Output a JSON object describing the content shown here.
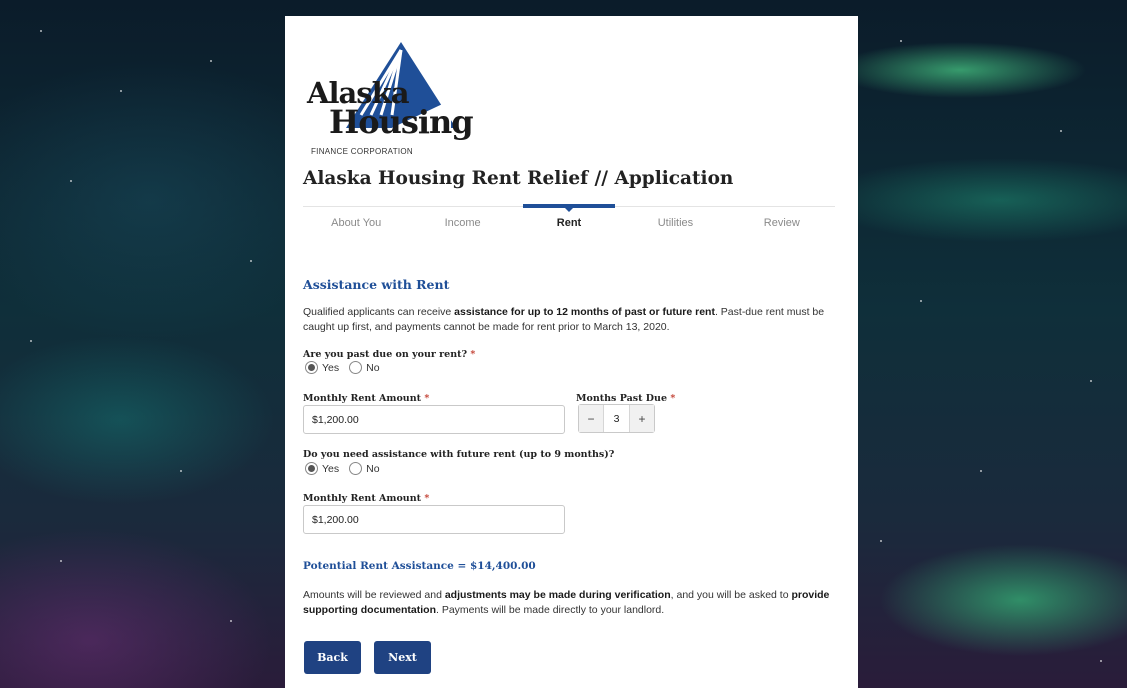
{
  "header": {
    "logo_line1": "Alaska",
    "logo_line2": "Housing",
    "logo_sub": "FINANCE CORPORATION",
    "title": "Alaska Housing Rent Relief // Application"
  },
  "steps": [
    {
      "label": "About You",
      "active": false
    },
    {
      "label": "Income",
      "active": false
    },
    {
      "label": "Rent",
      "active": true
    },
    {
      "label": "Utilities",
      "active": false
    },
    {
      "label": "Review",
      "active": false
    }
  ],
  "section": {
    "title": "Assistance with Rent",
    "intro_pre": "Qualified applicants can receive ",
    "intro_bold": "assistance for up to 12 months of past or future rent",
    "intro_post": ". Past-due rent must be caught up first, and payments cannot be made for rent prior to March 13, 2020."
  },
  "past_due": {
    "question": "Are you past due on your rent?",
    "required": "*",
    "yes_label": "Yes",
    "no_label": "No",
    "selected": "Yes"
  },
  "monthly_rent": {
    "label": "Monthly Rent Amount",
    "required": "*",
    "value": "$1,200.00"
  },
  "months_past_due": {
    "label": "Months Past Due",
    "required": "*",
    "minus": "−",
    "value": "3",
    "plus": "+"
  },
  "future_rent": {
    "question": "Do you need assistance with future rent (up to 9 months)?",
    "yes_label": "Yes",
    "no_label": "No",
    "selected": "Yes"
  },
  "future_monthly_rent": {
    "label": "Monthly Rent Amount",
    "required": "*",
    "value": "$1,200.00"
  },
  "potential": {
    "text": "Potential Rent Assistance = $14,400.00"
  },
  "note": {
    "t1": "Amounts will be reviewed and ",
    "b1": "adjustments may be made during verification",
    "t2": ", and you will be asked to ",
    "b2": "provide supporting documentation",
    "t3": ". Payments will be made directly to your landlord."
  },
  "buttons": {
    "back": "Back",
    "next": "Next"
  },
  "colors": {
    "brand_blue": "#1f4f98",
    "button_blue": "#1f4282",
    "required_red": "#c0392b"
  }
}
